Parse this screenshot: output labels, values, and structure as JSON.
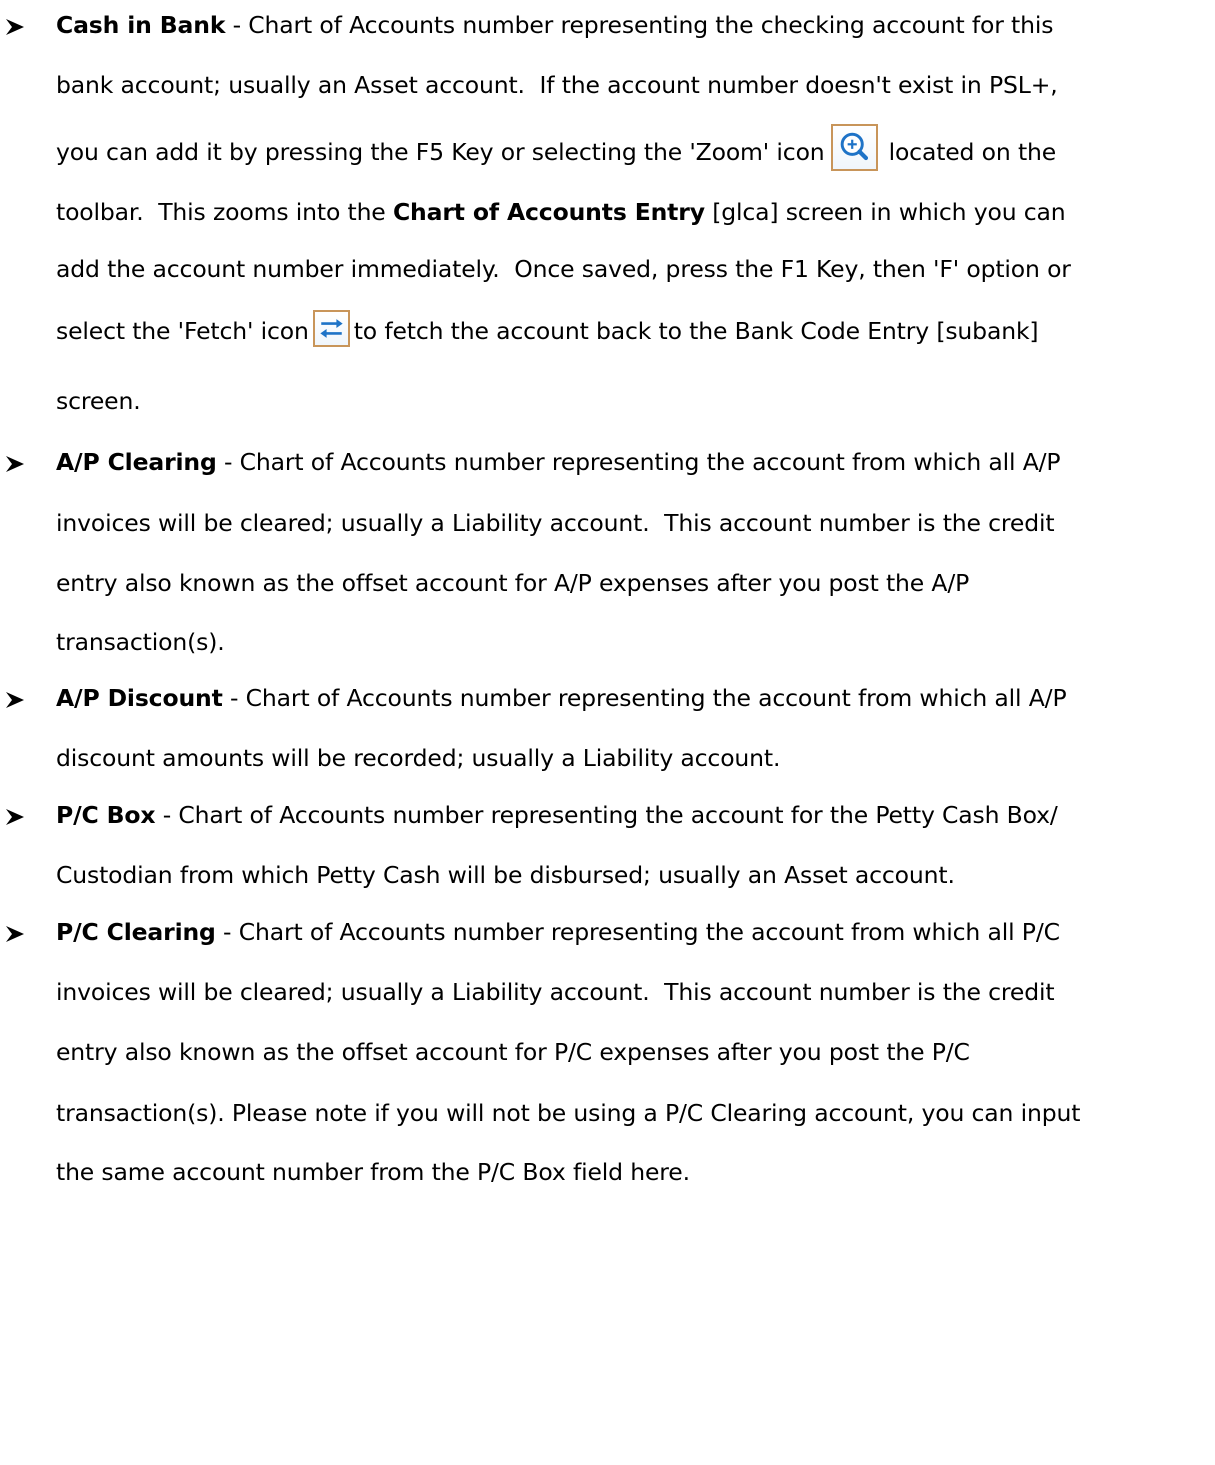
{
  "items": [
    {
      "term": "Cash in Bank",
      "lines": [
        [
          {
            "t": " - Chart of Accounts number representing the checking account for this"
          }
        ],
        [
          {
            "t": "bank account; usually an Asset account.  If the account number doesn't exist in PSL+,"
          }
        ],
        [
          {
            "t": "you can add it by pressing the F5 Key or selecting the 'Zoom' icon"
          },
          {
            "icon": "zoom-icon"
          },
          {
            "t": "located on the"
          }
        ],
        [
          {
            "t": "toolbar.  This zooms into the "
          },
          {
            "b": "Chart of Accounts Entry"
          },
          {
            "t": " [glca] screen in which you can"
          }
        ],
        [
          {
            "t": "add the account number immediately.  Once saved, press the F1 Key, then 'F' option or"
          }
        ],
        [
          {
            "t": "select the 'Fetch' icon"
          },
          {
            "icon": "fetch-icon"
          },
          {
            "t": "to fetch the account back to the Bank Code Entry [subank]"
          }
        ],
        [
          {
            "t": "screen."
          }
        ]
      ]
    },
    {
      "term": "A/P Clearing",
      "lines": [
        [
          {
            "t": " - Chart of Accounts number representing the account from which all A/P"
          }
        ],
        [
          {
            "t": "invoices will be cleared; usually a Liability account.  This account number is the credit"
          }
        ],
        [
          {
            "t": "entry also known as the offset account for A/P expenses after you post the A/P"
          }
        ],
        [
          {
            "t": "transaction(s)."
          }
        ]
      ]
    },
    {
      "term": "A/P Discount",
      "lines": [
        [
          {
            "t": " - Chart of Accounts number representing the account from which all A/P"
          }
        ],
        [
          {
            "t": "discount amounts will be recorded; usually a Liability account."
          }
        ]
      ]
    },
    {
      "term": "P/C Box",
      "lines": [
        [
          {
            "t": " - Chart of Accounts number representing the account for the Petty Cash Box/"
          }
        ],
        [
          {
            "t": "Custodian from which Petty Cash will be disbursed; usually an Asset account."
          }
        ]
      ]
    },
    {
      "term": "P/C Clearing",
      "lines": [
        [
          {
            "t": " - Chart of Accounts number representing the account from which all P/C"
          }
        ],
        [
          {
            "t": "invoices will be cleared; usually a Liability account.  This account number is the credit"
          }
        ],
        [
          {
            "t": "entry also known as the offset account for P/C expenses after you post the P/C"
          }
        ],
        [
          {
            "t": "transaction(s). Please note if you will not be using a P/C Clearing account, you can input"
          }
        ],
        [
          {
            "t": "the same account number from the P/C Box field here."
          }
        ]
      ]
    }
  ]
}
